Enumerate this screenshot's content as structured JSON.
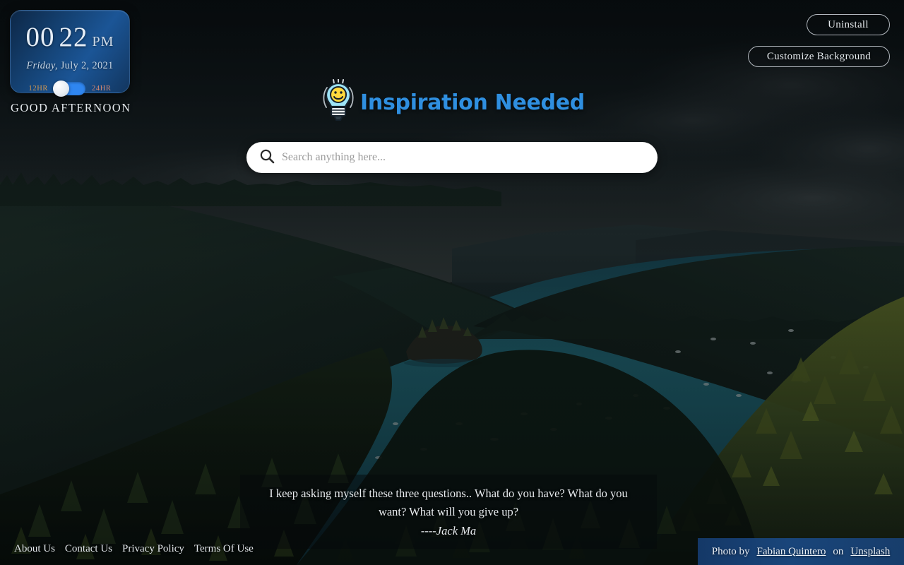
{
  "clock": {
    "hours": "00",
    "minutes": "22",
    "meridiem": "PM",
    "day_of_week": "Friday,",
    "date": "July 2, 2021",
    "format_12_label": "12HR",
    "format_24_label": "24HR",
    "active_format": "24HR",
    "greeting": "GOOD AFTERNOON"
  },
  "toolbar": {
    "uninstall_label": "Uninstall",
    "customize_background_label": "Customize Background"
  },
  "branding": {
    "logo_text": "Inspiration Needed",
    "logo_icon": "lightbulb-smiley-icon",
    "logo_color": "#2f8fe0",
    "bulb_color": "#9de4f7",
    "face_color": "#ffd93d"
  },
  "search": {
    "placeholder": "Search anything here...",
    "value": "",
    "icon": "search-icon"
  },
  "quote": {
    "text": "I keep asking myself these three questions.. What do you have? What do you want? What will you give up?",
    "author": "----Jack Ma"
  },
  "footer": {
    "links": [
      {
        "label": "About Us"
      },
      {
        "label": "Contact Us"
      },
      {
        "label": "Privacy Policy"
      },
      {
        "label": "Terms Of Use"
      }
    ]
  },
  "photo_credit": {
    "prefix": "Photo by",
    "photographer": "Fabian Quintero",
    "middle": "on",
    "source": "Unsplash"
  },
  "background": {
    "scene": "emerald-bay-lake-tahoe",
    "sky_color": "#14191b",
    "water_color": "#1d5c6b",
    "forest_color": "#16291f"
  }
}
